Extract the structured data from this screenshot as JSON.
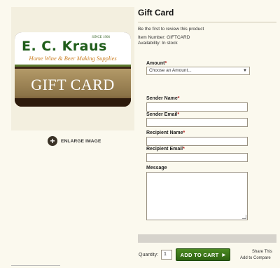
{
  "product": {
    "title": "Gift Card",
    "review_link": "Be the first to review this product",
    "item_number": "Item Number: GIFTCARD",
    "availability": "Availability: In stock"
  },
  "image": {
    "card_since": "SINCE 1906",
    "card_brand": "E. C. Kraus",
    "card_tagline": "Home Wine & Beer Making Supplies",
    "card_text": "GIFT CARD",
    "enlarge_icon": "+",
    "enlarge_label": "ENLARGE IMAGE"
  },
  "form": {
    "amount_label": "Amount",
    "amount_selected": "Choose an Amount...",
    "sender_name_label": "Sender Name",
    "sender_email_label": "Sender Email",
    "recipient_name_label": "Recipient Name",
    "recipient_email_label": "Recipient Email",
    "message_label": "Message",
    "required_mark": "*"
  },
  "cart": {
    "qty_label": "Quantity:",
    "qty_value": "1",
    "add_to_cart": "ADD TO CART",
    "share": "Share This",
    "compare": "Add to Compare"
  },
  "icons": {
    "dropdown": "chevron-down-icon",
    "cart_arrow": "play-arrow-icon",
    "enlarge": "plus-circle-icon"
  },
  "colors": {
    "page_bg": "#fbf9ee",
    "button_green": "#3a7419",
    "required_red": "#b01717"
  }
}
